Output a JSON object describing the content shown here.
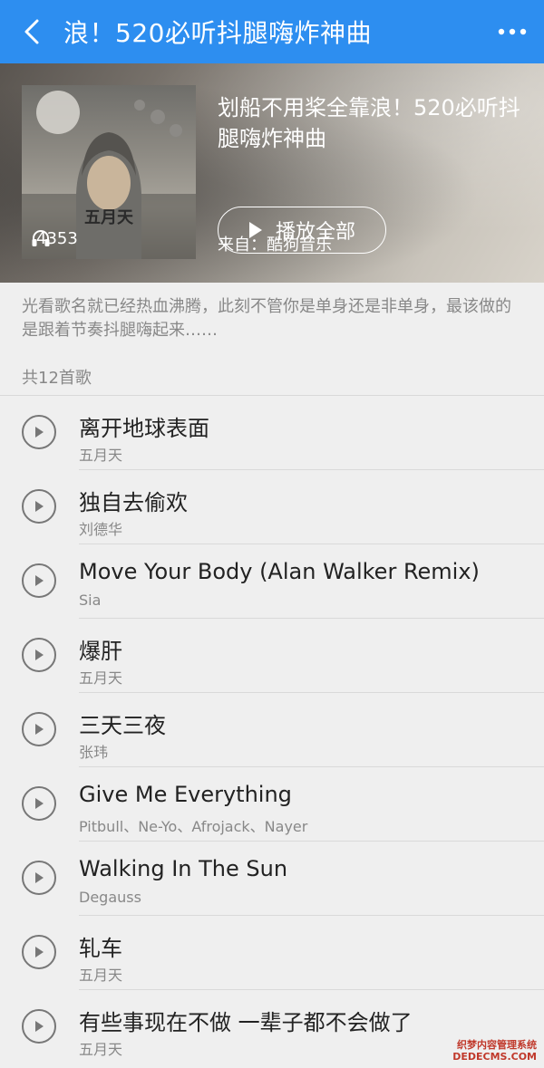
{
  "header": {
    "title": "浪！520必听抖腿嗨炸神曲",
    "back_icon": "chevron-left-icon",
    "more_icon": "more-icon",
    "bg_color": "#2d8ef0"
  },
  "playlist": {
    "cover_overlay_text": "五月天",
    "play_count": "4353",
    "title": "划船不用桨全靠浪！520必听抖腿嗨炸神曲",
    "source": "来自：酷狗音乐",
    "play_all_label": "播放全部",
    "description": "光看歌名就已经热血沸腾，此刻不管你是单身还是非单身，最该做的是跟着节奏抖腿嗨起来……",
    "song_count": "共12首歌"
  },
  "songs": [
    {
      "title": "离开地球表面",
      "artist": "五月天"
    },
    {
      "title": "独自去偷欢",
      "artist": "刘德华"
    },
    {
      "title": "Move Your Body (Alan Walker Remix)",
      "artist": "Sia"
    },
    {
      "title": "爆肝",
      "artist": "五月天"
    },
    {
      "title": "三天三夜",
      "artist": "张玮"
    },
    {
      "title": "Give Me Everything",
      "artist": "Pitbull、Ne-Yo、Afrojack、Nayer"
    },
    {
      "title": "Walking In The Sun",
      "artist": "Degauss"
    },
    {
      "title": "轧车",
      "artist": "五月天"
    },
    {
      "title": "有些事现在不做 一辈子都不会做了",
      "artist": "五月天"
    }
  ],
  "watermark": {
    "line1": "织梦内容管理系统",
    "line2": "DEDECMS.COM"
  }
}
